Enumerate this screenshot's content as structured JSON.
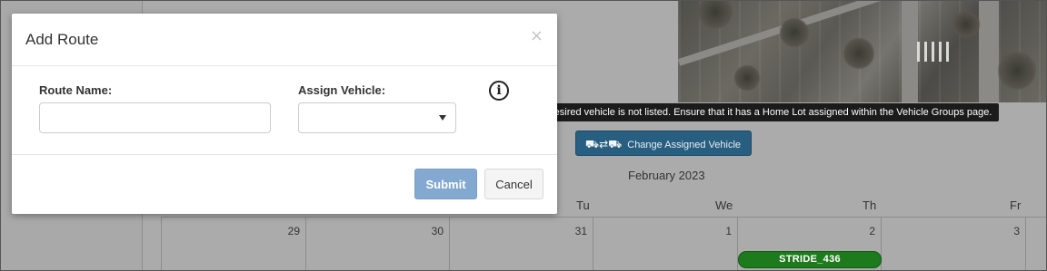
{
  "modal": {
    "title": "Add Route",
    "close_glyph": "×",
    "route_name_label": "Route Name:",
    "route_name_value": "",
    "assign_vehicle_label": "Assign Vehicle:",
    "assign_vehicle_value": "",
    "info_glyph": "i",
    "submit_label": "Submit",
    "cancel_label": "Cancel"
  },
  "tooltip": {
    "text": "If the desired vehicle is not listed.  Ensure that it has a Home Lot assigned within the Vehicle Groups page."
  },
  "toolbar": {
    "change_vehicle_icon": "⛟⇄⛟",
    "change_vehicle_label": "Change Assigned Vehicle"
  },
  "calendar": {
    "month_title": "February 2023",
    "day_headers": [
      "Tu",
      "We",
      "Th",
      "Fr"
    ],
    "dates": [
      "29",
      "30",
      "31",
      "1",
      "2",
      "3"
    ],
    "events": [
      {
        "label": "STRIDE_436",
        "color": "#1d7a1d"
      }
    ]
  },
  "colors": {
    "submit": "#84a9d0",
    "change_vehicle_button": "#285f80",
    "event_green": "#1d7a1d"
  },
  "icons": {
    "close": "close-icon",
    "info": "info-icon",
    "change_vehicle": "bus-swap-icon",
    "select_caret": "chevron-down-icon"
  }
}
